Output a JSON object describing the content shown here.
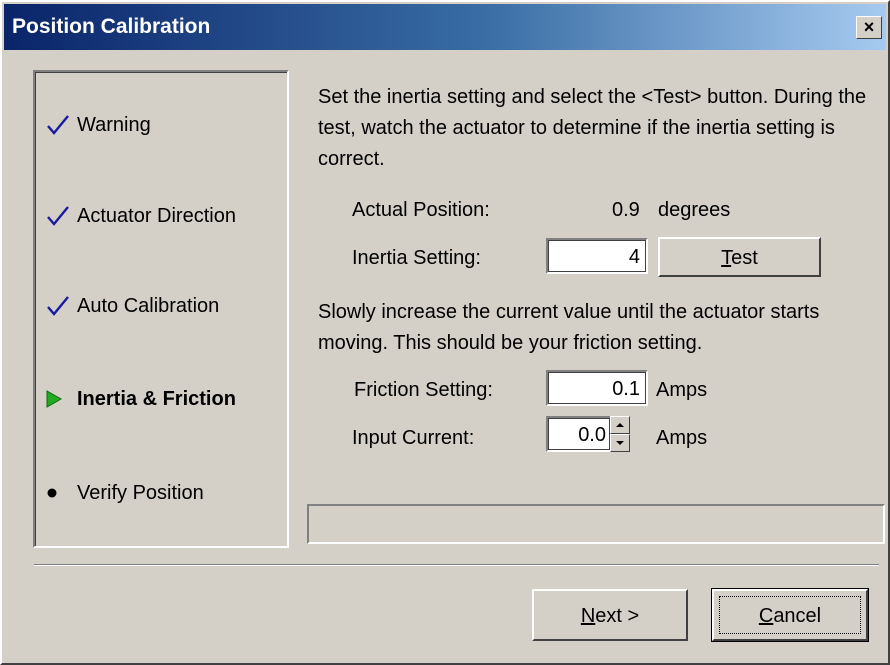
{
  "window": {
    "title": "Position Calibration",
    "close_glyph": "×",
    "close_icon": "close-icon"
  },
  "steps": [
    {
      "label": "Warning",
      "status": "done",
      "icon": "checkmark-icon"
    },
    {
      "label": "Actuator Direction",
      "status": "done",
      "icon": "checkmark-icon"
    },
    {
      "label": "Auto Calibration",
      "status": "done",
      "icon": "checkmark-icon"
    },
    {
      "label": "Inertia & Friction",
      "status": "current",
      "icon": "play-arrow-icon"
    },
    {
      "label": "Verify Position",
      "status": "pending",
      "icon": "bullet-icon"
    }
  ],
  "colors": {
    "titlebar_start": "#0a246a",
    "titlebar_end": "#a6caf0",
    "checkmark": "#1a1aa0",
    "current_arrow": "#22aa22",
    "face": "#d4d0c8"
  },
  "inertia": {
    "instructions": "Set the inertia setting and select the <Test> button.  During the test, watch the actuator to determine if the inertia setting is correct.",
    "actual_position_label": "Actual Position:",
    "actual_position_value": "0.9",
    "actual_position_unit": "degrees",
    "inertia_label": "Inertia Setting:",
    "inertia_value": "4",
    "test_button_mnemonic": "T",
    "test_button_rest": "est"
  },
  "friction": {
    "instructions": "Slowly increase the current value until the actuator starts moving.  This should be your friction setting.",
    "friction_label": "Friction Setting:",
    "friction_value": "0.1",
    "friction_unit": "Amps",
    "current_label": "Input Current:",
    "current_value": "0.0",
    "current_unit": "Amps"
  },
  "footer": {
    "next_mnemonic": "N",
    "next_rest": "ext >",
    "cancel_mnemonic": "C",
    "cancel_rest": "ancel"
  }
}
